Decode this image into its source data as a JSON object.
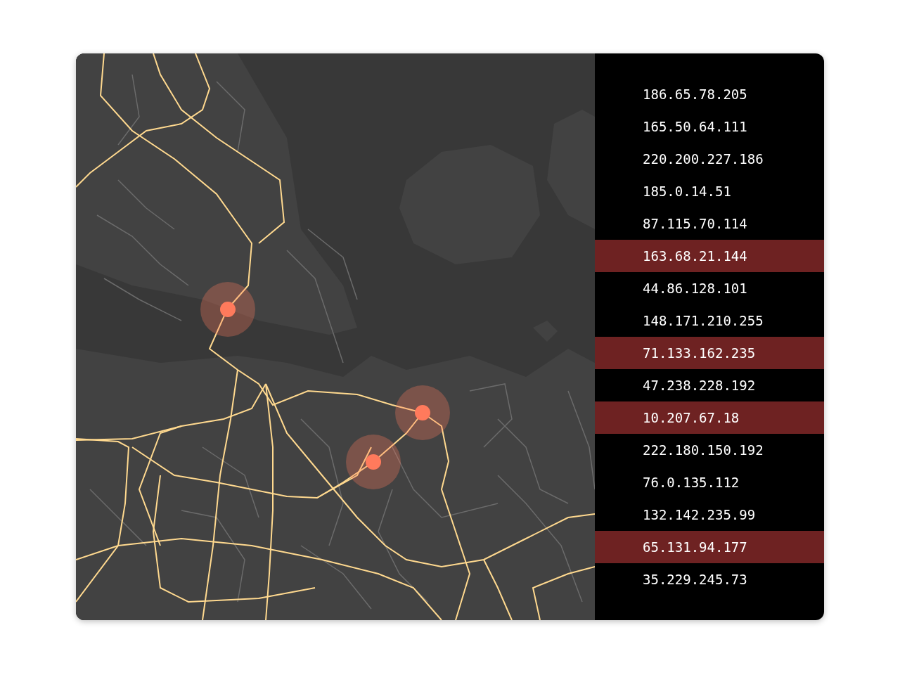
{
  "addresses": [
    {
      "ip": "186.65.78.205",
      "selected": false
    },
    {
      "ip": "165.50.64.111",
      "selected": false
    },
    {
      "ip": "220.200.227.186",
      "selected": false
    },
    {
      "ip": "185.0.14.51",
      "selected": false
    },
    {
      "ip": "87.115.70.114",
      "selected": false
    },
    {
      "ip": "163.68.21.144",
      "selected": true
    },
    {
      "ip": "44.86.128.101",
      "selected": false
    },
    {
      "ip": "148.171.210.255",
      "selected": false
    },
    {
      "ip": "71.133.162.235",
      "selected": true
    },
    {
      "ip": "47.238.228.192",
      "selected": false
    },
    {
      "ip": "10.207.67.18",
      "selected": true
    },
    {
      "ip": "222.180.150.192",
      "selected": false
    },
    {
      "ip": "76.0.135.112",
      "selected": false
    },
    {
      "ip": "132.142.235.99",
      "selected": false
    },
    {
      "ip": "65.131.94.177",
      "selected": true
    },
    {
      "ip": "35.229.245.73",
      "selected": false
    }
  ]
}
